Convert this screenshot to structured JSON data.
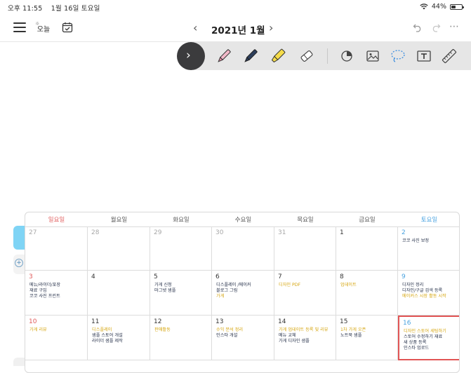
{
  "status": {
    "time": "오후 11:55",
    "date": "1월 16일 토요일",
    "battery_text": "44%",
    "battery_level": 0.44
  },
  "header": {
    "today_label": "오늘",
    "month_title": "2021년 1월"
  },
  "toolbar": {
    "tools": [
      "chevron-right-icon",
      "pink-pen-icon",
      "navy-pen-icon",
      "highlighter-icon",
      "eraser-icon",
      "shape-icon",
      "image-icon",
      "lasso-icon",
      "text-icon",
      "ruler-icon"
    ]
  },
  "calendar": {
    "weekdays": [
      "일요일",
      "월요일",
      "화요일",
      "수요일",
      "목요일",
      "금요일",
      "토요일"
    ],
    "weeks": [
      [
        {
          "day": "27",
          "notes": []
        },
        {
          "day": "28",
          "notes": []
        },
        {
          "day": "29",
          "notes": []
        },
        {
          "day": "30",
          "notes": []
        },
        {
          "day": "31",
          "notes": []
        },
        {
          "day": "1",
          "notes": []
        },
        {
          "day": "2",
          "notes": [
            {
              "text": "코코 사진 보정",
              "color": "dark"
            }
          ]
        }
      ],
      [
        {
          "day": "3",
          "notes": [
            {
              "text": "메뉴/라이더/포장",
              "color": "dark"
            },
            {
              "text": "재료 구입",
              "color": "dark"
            },
            {
              "text": "코코 사진 프린트",
              "color": "dark"
            }
          ]
        },
        {
          "day": "4",
          "notes": []
        },
        {
          "day": "5",
          "notes": [
            {
              "text": "가게 신청",
              "color": "dark"
            },
            {
              "text": "마그넷 샘플",
              "color": "dark"
            }
          ]
        },
        {
          "day": "6",
          "notes": [
            {
              "text": "디스플레이 /메이커",
              "color": "dark"
            },
            {
              "text": "블로그 그림",
              "color": "dark"
            },
            {
              "text": "가게",
              "color": "yellow"
            }
          ]
        },
        {
          "day": "7",
          "notes": [
            {
              "text": "디자인 PDF",
              "color": "yellow"
            }
          ]
        },
        {
          "day": "8",
          "notes": [
            {
              "text": "업데이트",
              "color": "yellow"
            }
          ]
        },
        {
          "day": "9",
          "notes": [
            {
              "text": "디자인 정리",
              "color": "dark"
            },
            {
              "text": "디자인/구글 검색 등록",
              "color": "dark"
            },
            {
              "text": "메이커스 시장 활동 시작",
              "color": "yellow"
            }
          ]
        }
      ],
      [
        {
          "day": "10",
          "notes": [
            {
              "text": "가게 리뷰",
              "color": "yellow"
            }
          ]
        },
        {
          "day": "11",
          "notes": [
            {
              "text": "디스플레이",
              "color": "yellow"
            },
            {
              "text": "샘플 스토어 개설",
              "color": "dark"
            },
            {
              "text": "라이더 샘플 제작",
              "color": "dark"
            }
          ]
        },
        {
          "day": "12",
          "notes": [
            {
              "text": "판매활동",
              "color": "yellow"
            }
          ]
        },
        {
          "day": "13",
          "notes": [
            {
              "text": "수익 분석 정리",
              "color": "yellow"
            },
            {
              "text": "인스타 개설",
              "color": "dark"
            }
          ]
        },
        {
          "day": "14",
          "notes": [
            {
              "text": "가게 업데이트 등록 및 리뷰",
              "color": "yellow"
            },
            {
              "text": "메뉴 교체",
              "color": "dark"
            },
            {
              "text": "가게 디자인 샘플",
              "color": "dark"
            }
          ]
        },
        {
          "day": "15",
          "notes": [
            {
              "text": "1차 가게 오픈",
              "color": "yellow"
            },
            {
              "text": "노트북 샘플",
              "color": "dark"
            }
          ]
        },
        {
          "day": "16",
          "notes": [
            {
              "text": "디자인 스토어 세팅하기",
              "color": "yellow"
            },
            {
              "text": "스토어 수정하기 재료",
              "color": "dark"
            },
            {
              "text": "새 상품 등록",
              "color": "dark"
            },
            {
              "text": "인스타 업로드",
              "color": "dark"
            }
          ]
        }
      ]
    ]
  }
}
